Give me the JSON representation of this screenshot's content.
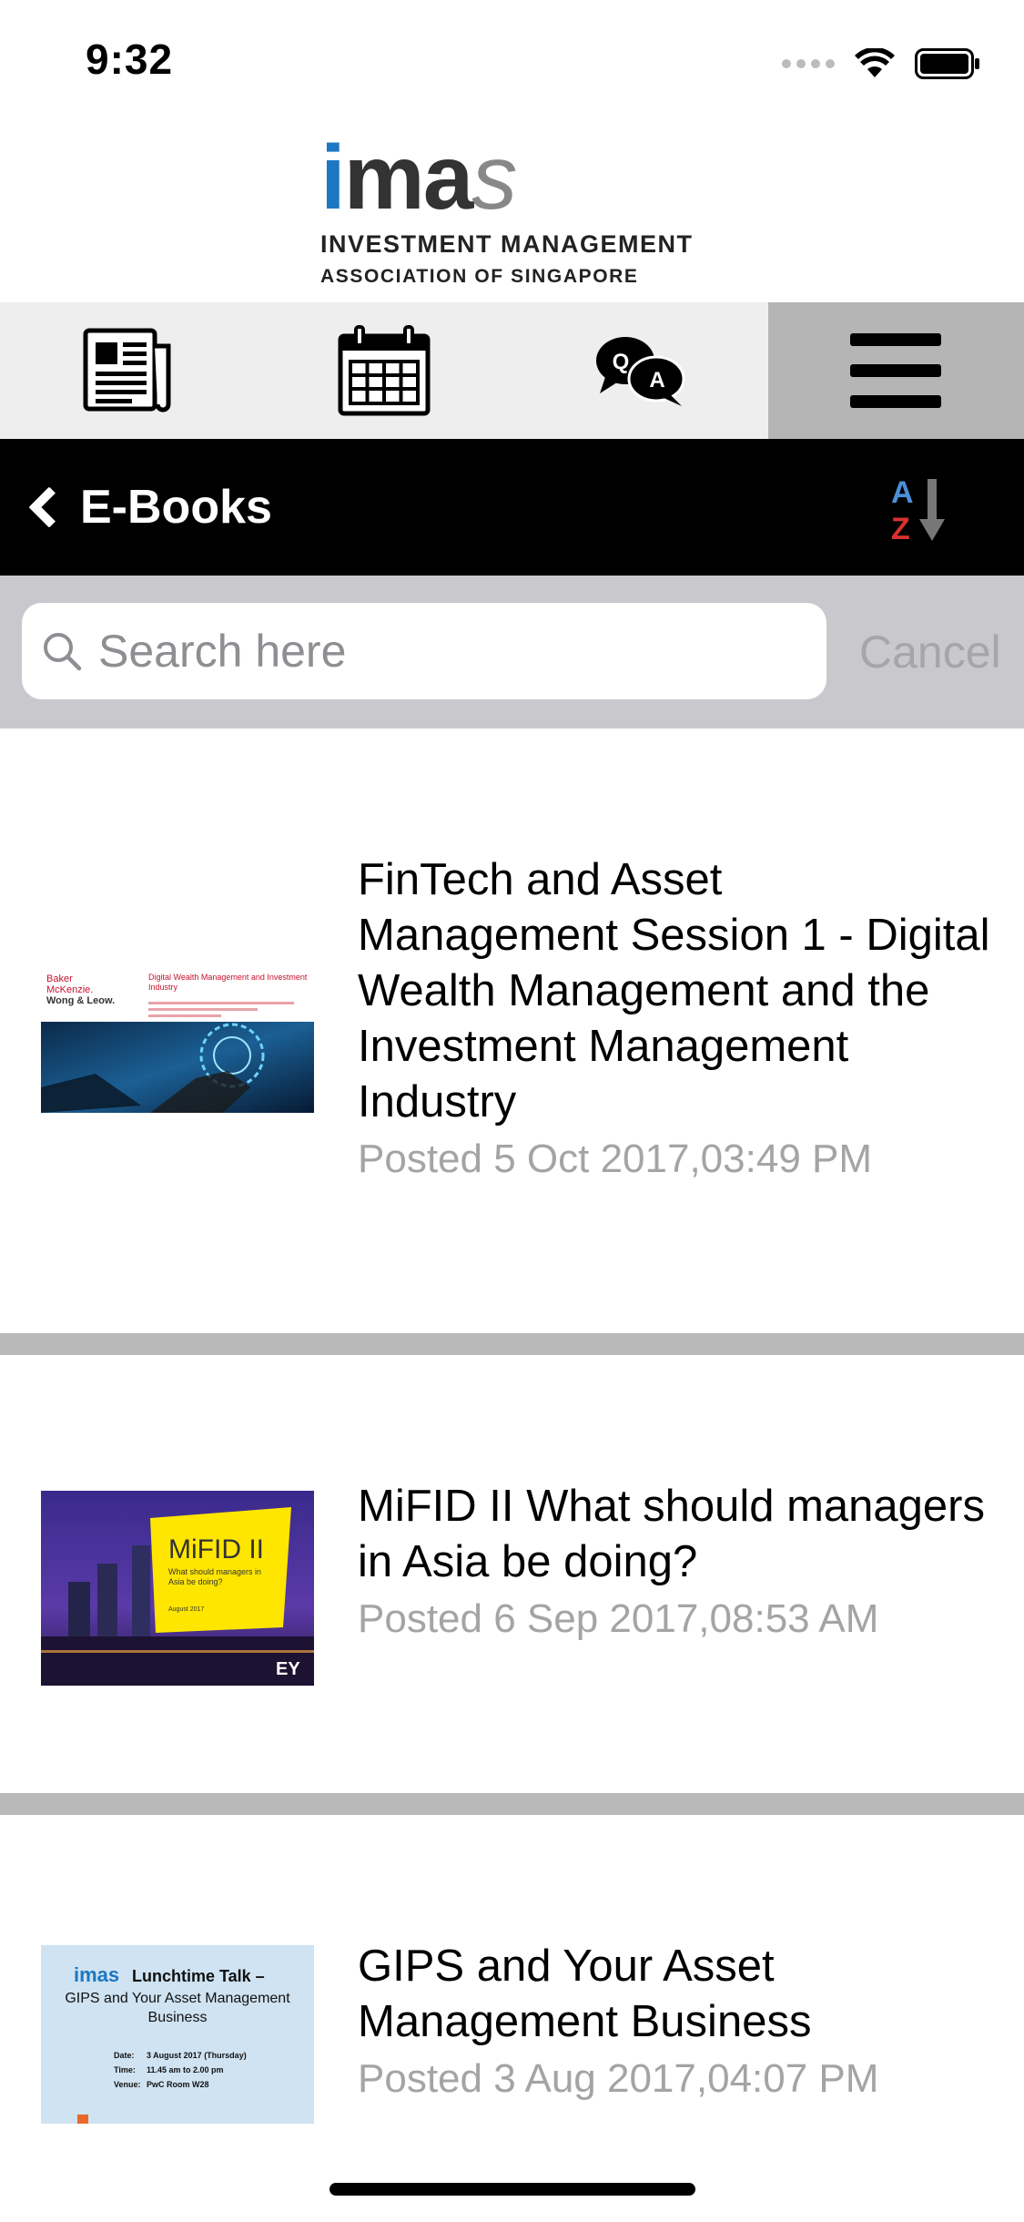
{
  "status_bar": {
    "time": "9:32"
  },
  "logo": {
    "word_i": "i",
    "word_ma": "ma",
    "word_s": "s",
    "line1": "INVESTMENT MANAGEMENT",
    "line2": "ASSOCIATION OF SINGAPORE"
  },
  "toolbar": {
    "items": [
      {
        "icon": "newspaper-icon"
      },
      {
        "icon": "calendar-icon"
      },
      {
        "icon": "qa-chat-icon",
        "q": "Q",
        "a": "A"
      },
      {
        "icon": "menu-icon",
        "active": true
      }
    ]
  },
  "header": {
    "title": "E-Books",
    "sort_a": "A",
    "sort_z": "Z"
  },
  "search": {
    "placeholder": "Search here",
    "value": "",
    "cancel_label": "Cancel"
  },
  "ebooks": [
    {
      "title": "FinTech and Asset Management  Session 1 - Digital Wealth Management and the Investment Management Industry",
      "date": "Posted 5 Oct 2017,03:49 PM",
      "thumb": {
        "brand1": "Baker",
        "brand2": "McKenzie.",
        "brand3": "Wong & Leow.",
        "heading": "Digital Wealth Management and Investment Industry"
      }
    },
    {
      "title": "MiFID II What should managers in Asia be doing?",
      "date": "Posted 6 Sep 2017,08:53 AM",
      "thumb": {
        "heading": "MiFID II",
        "sub": "What should managers in Asia be doing?",
        "month": "August 2017",
        "brand": "EY"
      }
    },
    {
      "title": "GIPS and Your Asset Management Business",
      "date": "Posted 3 Aug 2017,04:07 PM",
      "thumb": {
        "logo": "imas",
        "heading": "Lunchtime Talk –",
        "sub": "GIPS and Your Asset Management Business",
        "date_label": "Date:",
        "date_value": "3 August 2017 (Thursday)",
        "time_label": "Time:",
        "time_value": "11.45 am to 2.00 pm",
        "venue_label": "Venue:",
        "venue_value": "PwC Room W28"
      }
    }
  ],
  "colors": {
    "brand_blue": "#1d77c2",
    "toolbar_bg": "#eeeeee",
    "toolbar_active": "#b5b5b5",
    "header_bg": "#000000",
    "date_gray": "#a4a4a4",
    "divider": "#b9b9b9"
  }
}
